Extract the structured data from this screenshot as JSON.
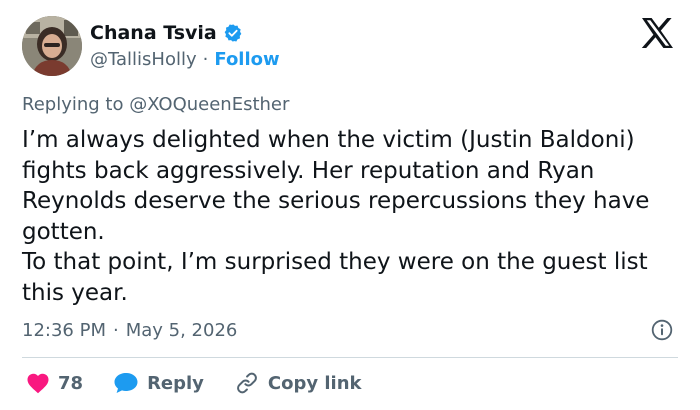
{
  "author": {
    "display_name": "Chana Tsvia",
    "handle": "@TallisHolly",
    "separator": "·",
    "follow_label": "Follow"
  },
  "reply_context": {
    "prefix": "Replying to",
    "mention": "@XOQueenEsther"
  },
  "tweet": {
    "paragraph_1": "I’m always delighted when the victim (Justin Baldoni) fights back aggressively. Her reputation and Ryan Reynolds deserve the serious repercussions they have gotten.",
    "paragraph_2": "To that point, I’m surprised they were on the guest list this year."
  },
  "meta": {
    "time": "12:36 PM",
    "separator": "·",
    "date": "May 5, 2026"
  },
  "actions": {
    "like_count": "78",
    "reply_label": "Reply",
    "copy_link_label": "Copy link"
  },
  "icons": {
    "verified": "verified-badge-icon",
    "logo": "x-logo-icon",
    "info": "info-icon",
    "like": "heart-icon",
    "reply": "speech-bubble-icon",
    "copy": "link-icon"
  },
  "colors": {
    "accent": "#1d9bf0",
    "like": "#f91880",
    "text_primary": "#0f1419",
    "text_secondary": "#536471",
    "divider": "#cfd9de"
  }
}
